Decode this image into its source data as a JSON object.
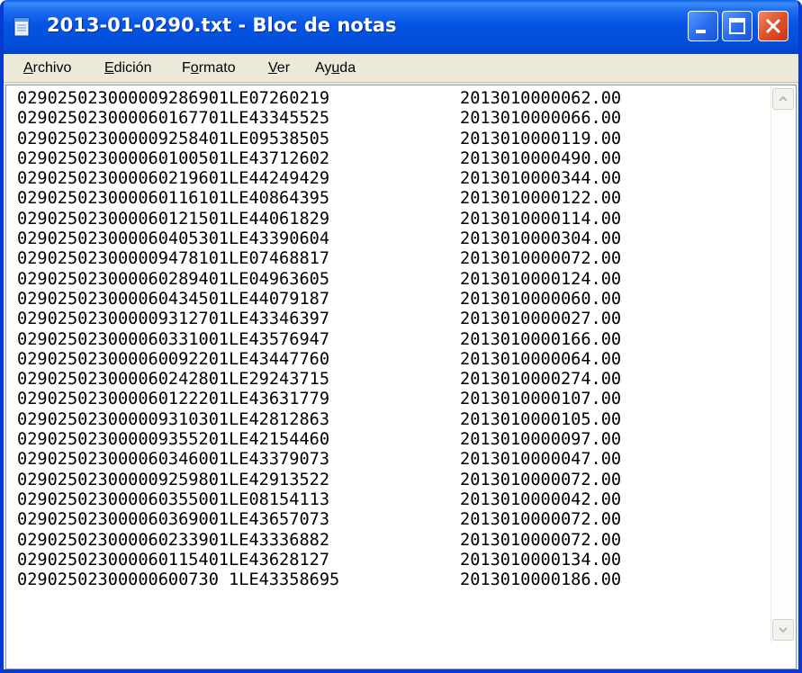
{
  "window": {
    "title": "2013-01-0290.txt - Bloc de notas",
    "icon": "notepad-icon",
    "controls": [
      "minimize-icon",
      "maximize-icon",
      "close-icon"
    ]
  },
  "menu": {
    "items": [
      {
        "prefix": "",
        "accel": "A",
        "rest": "rchivo"
      },
      {
        "prefix": "",
        "accel": "E",
        "rest": "dición"
      },
      {
        "prefix": "F",
        "accel": "o",
        "rest": "rmato"
      },
      {
        "prefix": "",
        "accel": "V",
        "rest": "er"
      },
      {
        "prefix": "Ay",
        "accel": "u",
        "rest": "da"
      }
    ]
  },
  "document": {
    "lines": [
      {
        "a": "029025023000009286901LE07260219",
        "b": "2013010000062.00"
      },
      {
        "a": "029025023000060167701LE43345525",
        "b": "2013010000066.00"
      },
      {
        "a": "029025023000009258401LE09538505",
        "b": "2013010000119.00"
      },
      {
        "a": "029025023000060100501LE43712602",
        "b": "2013010000490.00"
      },
      {
        "a": "029025023000060219601LE44249429",
        "b": "2013010000344.00"
      },
      {
        "a": "029025023000060116101LE40864395",
        "b": "2013010000122.00"
      },
      {
        "a": "029025023000060121501LE44061829",
        "b": "2013010000114.00"
      },
      {
        "a": "029025023000060405301LE43390604",
        "b": "2013010000304.00"
      },
      {
        "a": "029025023000009478101LE07468817",
        "b": "2013010000072.00"
      },
      {
        "a": "029025023000060289401LE04963605",
        "b": "2013010000124.00"
      },
      {
        "a": "029025023000060434501LE44079187",
        "b": "2013010000060.00"
      },
      {
        "a": "029025023000009312701LE43346397",
        "b": "2013010000027.00"
      },
      {
        "a": "029025023000060331001LE43576947",
        "b": "2013010000166.00"
      },
      {
        "a": "029025023000060092201LE43447760",
        "b": "2013010000064.00"
      },
      {
        "a": "029025023000060242801LE29243715",
        "b": "2013010000274.00"
      },
      {
        "a": "029025023000060122201LE43631779",
        "b": "2013010000107.00"
      },
      {
        "a": "029025023000009310301LE42812863",
        "b": "2013010000105.00"
      },
      {
        "a": "029025023000009355201LE42154460",
        "b": "2013010000097.00"
      },
      {
        "a": "029025023000060346001LE43379073",
        "b": "2013010000047.00"
      },
      {
        "a": "029025023000009259801LE42913522",
        "b": "2013010000072.00"
      },
      {
        "a": "029025023000060355001LE08154113",
        "b": "2013010000042.00"
      },
      {
        "a": "029025023000060369001LE43657073",
        "b": "2013010000072.00"
      },
      {
        "a": "029025023000060233901LE43336882",
        "b": "2013010000072.00"
      },
      {
        "a": "029025023000060115401LE43628127",
        "b": "2013010000134.00"
      },
      {
        "a": "02902502300000600730 1LE43358695",
        "b": "2013010000186.00"
      }
    ]
  }
}
